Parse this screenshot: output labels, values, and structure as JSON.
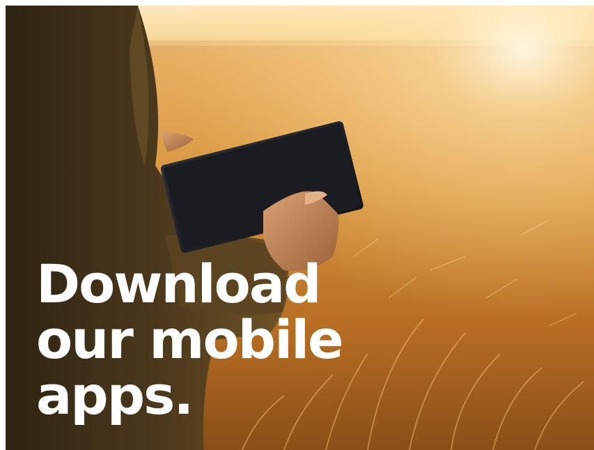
{
  "headline": {
    "line1": "Download",
    "line2": "our mobile",
    "line3": "apps."
  },
  "photo": {
    "subject": "person-holding-tablet-in-wheat-field",
    "colors": {
      "sky": "#fff1cf",
      "sun_glow": "#fff7e0",
      "field_light": "#e5a24a",
      "field_mid": "#c9832b",
      "field_dark": "#7e4614",
      "jacket": "#4d3a1e",
      "skin": "#c58a5b",
      "tablet": "#1d1f26"
    }
  }
}
